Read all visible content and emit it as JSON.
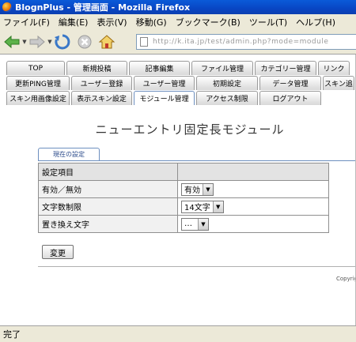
{
  "window": {
    "title": "BlognPlus - 管理画面 - Mozilla Firefox"
  },
  "menu": [
    "ファイル(F)",
    "編集(E)",
    "表示(V)",
    "移動(G)",
    "ブックマーク(B)",
    "ツール(T)",
    "ヘルプ(H)"
  ],
  "address": {
    "url": "http://k.ita.jp/test/admin.php?mode=module"
  },
  "tabs": {
    "row1": [
      {
        "label": "TOP",
        "w": 74
      },
      {
        "label": "新規投稿",
        "w": 77
      },
      {
        "label": "記事編集",
        "w": 77
      },
      {
        "label": "ファイル管理",
        "w": 78
      },
      {
        "label": "カテゴリー管理",
        "w": 78
      },
      {
        "label": "リンク",
        "w": 40
      }
    ],
    "row2": [
      {
        "label": "更新PING管理",
        "w": 80
      },
      {
        "label": "ユーザー登録",
        "w": 77
      },
      {
        "label": "ユーザー管理",
        "w": 77
      },
      {
        "label": "初期設定",
        "w": 78
      },
      {
        "label": "データ管理",
        "w": 78
      },
      {
        "label": "スキン追",
        "w": 40
      }
    ],
    "row3": [
      {
        "label": "スキン用画像設定",
        "w": 80
      },
      {
        "label": "表示スキン設定",
        "w": 77
      },
      {
        "label": "モジュール管理",
        "w": 77,
        "active": true
      },
      {
        "label": "アクセス制限",
        "w": 78
      },
      {
        "label": "ログアウト",
        "w": 78
      }
    ]
  },
  "page": {
    "heading": "ニューエントリ固定長モジュール",
    "subtab": "現在の設定",
    "table_header": "設定項目",
    "rows": [
      {
        "label": "有効／無効",
        "value": "有効"
      },
      {
        "label": "文字数制限",
        "value": "14文字"
      },
      {
        "label": "置き換え文字",
        "value": "…"
      }
    ],
    "change_button": "変更",
    "copyright": "Copyright"
  },
  "status": {
    "text": "完了"
  }
}
